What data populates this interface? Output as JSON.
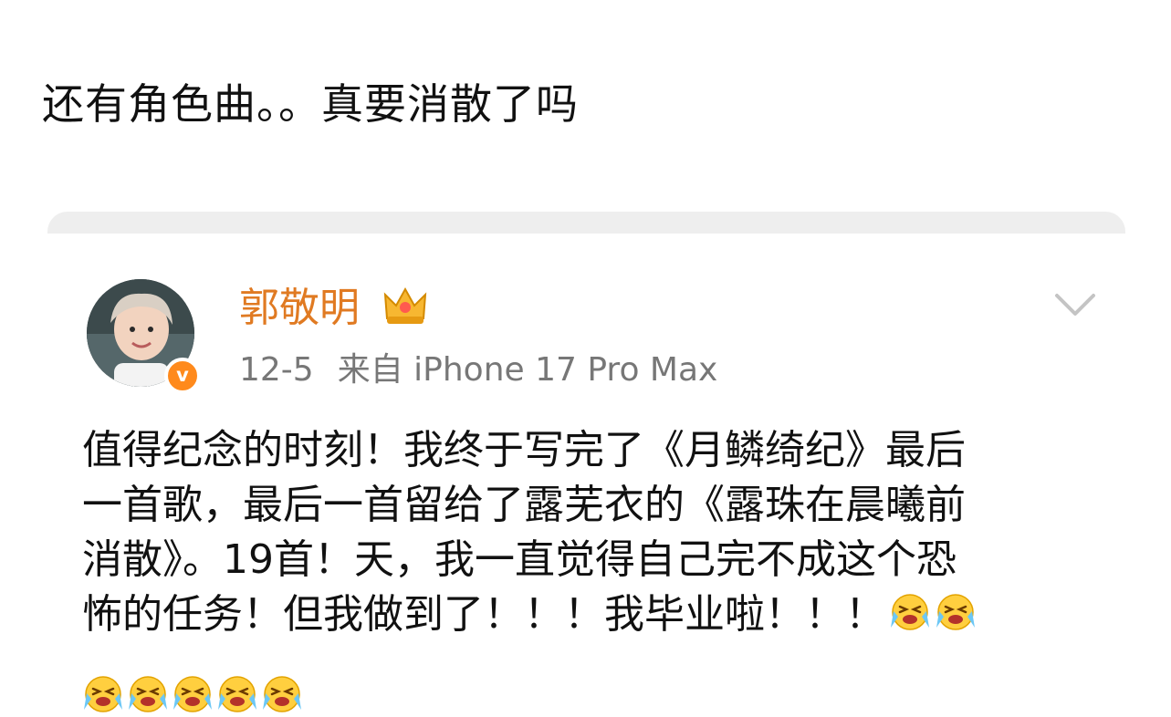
{
  "caption": "还有角色曲。。真要消散了吗",
  "post": {
    "author": "郭敬明",
    "badge_icon": "crown-icon",
    "verified_icon": "v",
    "date": "12-5",
    "source": "来自 iPhone 17 Pro Max",
    "lines": [
      "值得纪念的时刻！我终于写完了《月鳞绮纪》最后",
      "一首歌，最后一首留给了露芜衣的《露珠在晨曦前",
      "消散》。19首！天，我一直觉得自己完不成这个恐",
      "怖的任务！但我做到了！！！我毕业啦！！！"
    ],
    "emoji_name": "crying-laughing-emoji",
    "inline_emoji_count": 2,
    "trailing_emoji_count": 5
  },
  "colors": {
    "author": "#e07a22",
    "verified": "#ff8a1c",
    "meta": "#777777"
  }
}
